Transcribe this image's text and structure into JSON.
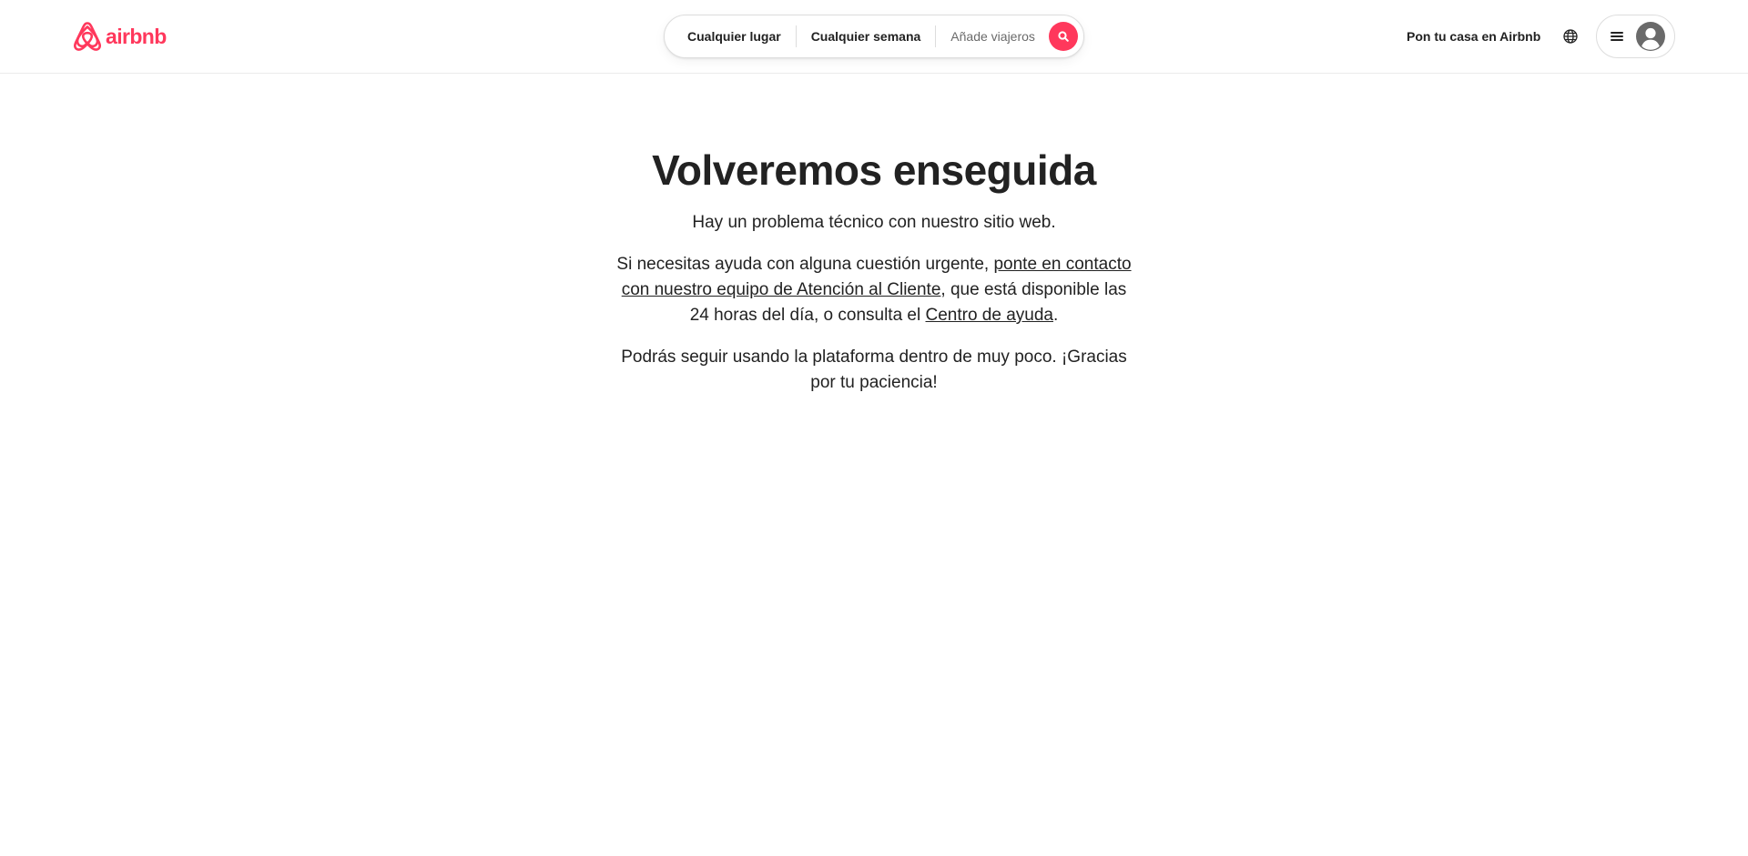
{
  "colors": {
    "brand": "#FF385C",
    "text": "#222222",
    "muted": "#6A6A6A",
    "border": "#DDDDDD"
  },
  "header": {
    "logo": {
      "icon": "airbnb-logo-icon",
      "text": "airbnb"
    },
    "search": {
      "where": "Cualquier lugar",
      "when": "Cualquier semana",
      "guests": "Añade viajeros",
      "button_icon": "search-icon"
    },
    "host_link": "Pon tu casa en Airbnb",
    "language_icon": "globe-icon",
    "menu_icon": "hamburger-menu-icon",
    "avatar_icon": "user-avatar-icon"
  },
  "main": {
    "title": "Volveremos enseguida",
    "problem": "Hay un problema técnico con nuestro sitio web.",
    "help": {
      "before": "Si necesitas ayuda con alguna cuestión urgente, ",
      "contact_link": "ponte en contacto con nuestro equipo de Atención al Cliente",
      "middle": ", que está disponible las 24 horas del día, o consulta el ",
      "help_center_link": "Centro de ayuda",
      "end": "."
    },
    "patience": "Podrás seguir usando la plataforma dentro de muy poco. ¡Gracias por tu paciencia!"
  }
}
